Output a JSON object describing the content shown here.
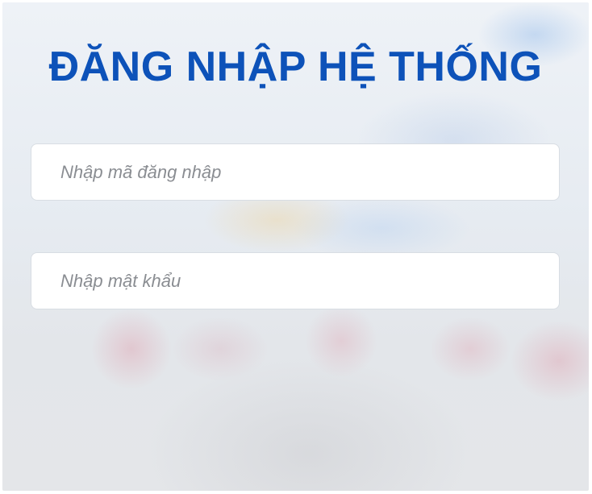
{
  "login": {
    "title": "ĐĂNG NHẬP HỆ THỐNG",
    "username": {
      "value": "",
      "placeholder": "Nhập mã đăng nhập"
    },
    "password": {
      "value": "",
      "placeholder": "Nhập mật khẩu"
    }
  },
  "colors": {
    "title": "#0d52b9",
    "field_background": "#ffffff",
    "placeholder": "#8a8d92"
  }
}
